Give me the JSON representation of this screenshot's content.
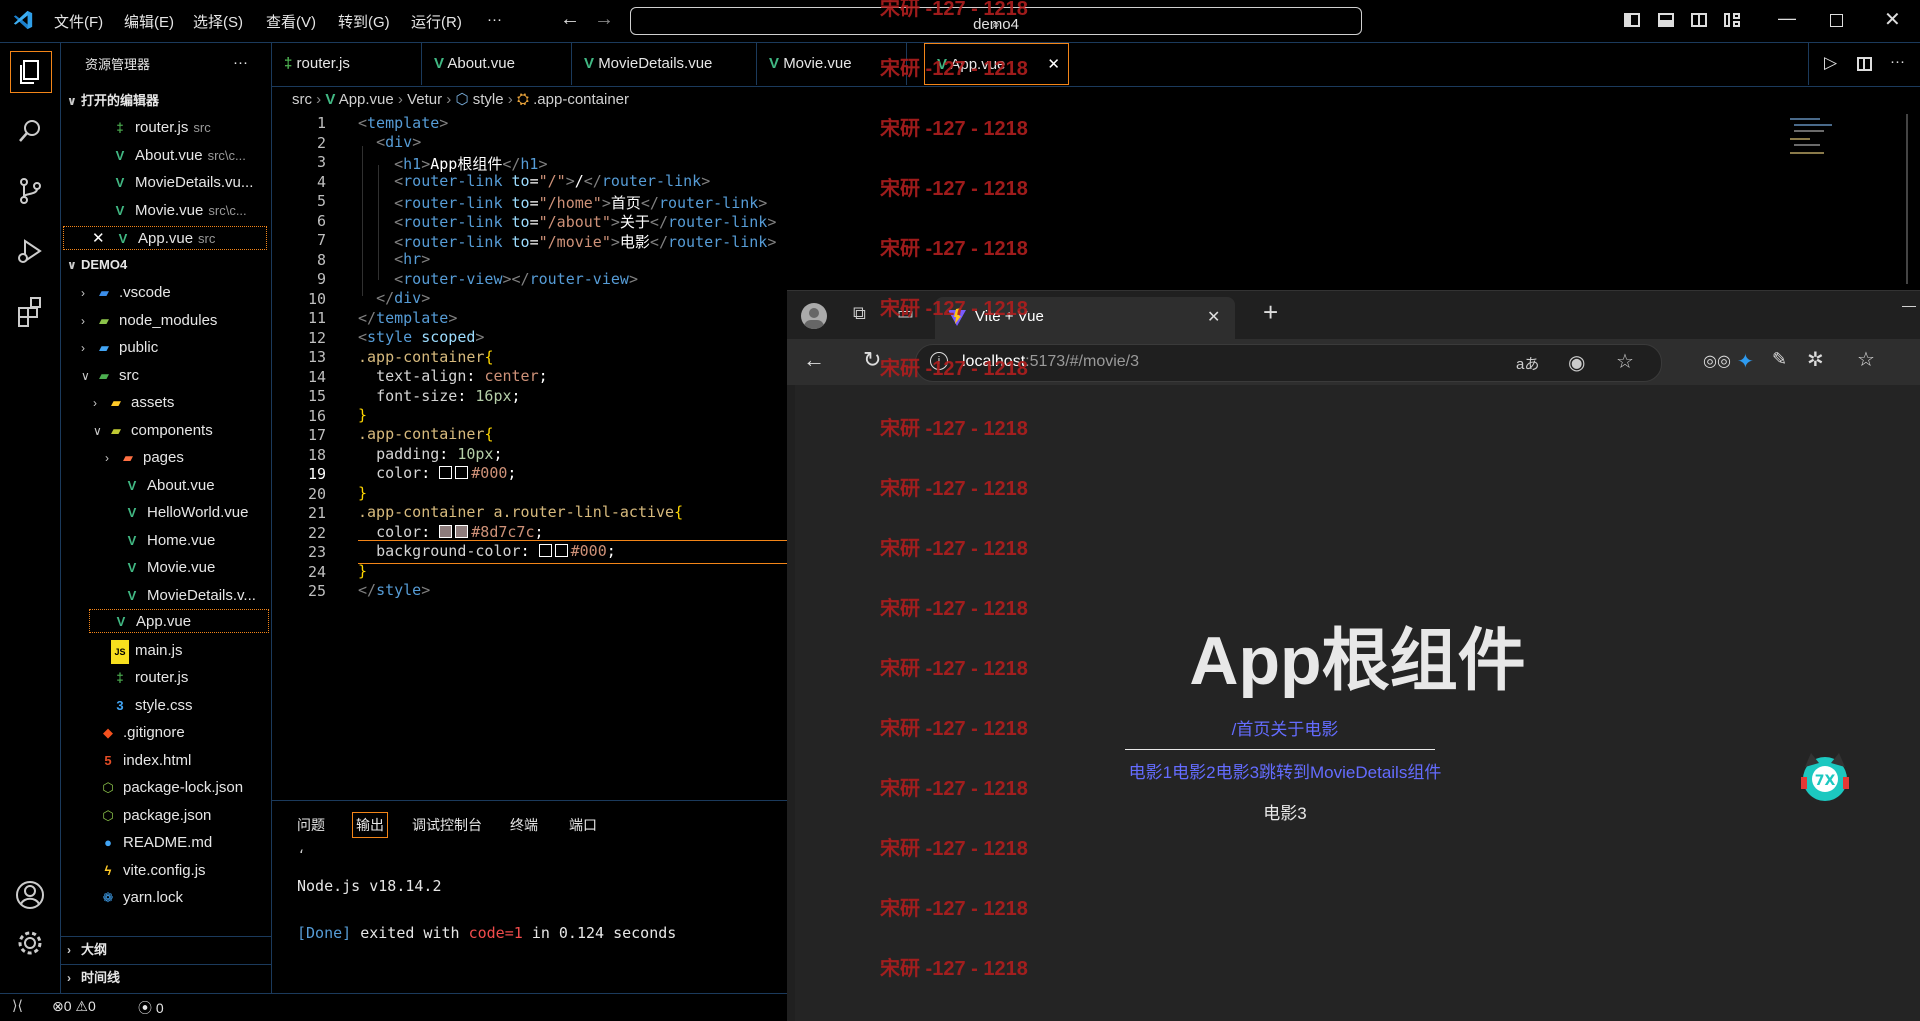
{
  "menu": [
    "文件(F)",
    "编辑(E)",
    "选择(S)",
    "查看(V)",
    "转到(G)",
    "运行(R)",
    "···"
  ],
  "search": {
    "text": "demo4"
  },
  "sidebar": {
    "title": "资源管理器",
    "more": "···",
    "open_editors_head": "打开的编辑器",
    "open_editors": [
      {
        "name": "router.js",
        "desc": "src"
      },
      {
        "name": "About.vue",
        "desc": "src\\c..."
      },
      {
        "name": "MovieDetails.vu...",
        "desc": ""
      },
      {
        "name": "Movie.vue",
        "desc": "src\\c..."
      },
      {
        "name": "App.vue",
        "desc": "src"
      }
    ],
    "project_head": "DEMO4",
    "tree": [
      ".vscode",
      "node_modules",
      "public",
      "src",
      "assets",
      "components",
      "pages",
      "About.vue",
      "HelloWorld.vue",
      "Home.vue",
      "Movie.vue",
      "MovieDetails.v...",
      "App.vue",
      "main.js",
      "router.js",
      "style.css",
      ".gitignore",
      "index.html",
      "package-lock.json",
      "package.json",
      "README.md",
      "vite.config.js",
      "yarn.lock"
    ],
    "outline_head": "大纲",
    "timeline_head": "时间线"
  },
  "tabs": [
    "router.js",
    "About.vue",
    "MovieDetails.vue",
    "Movie.vue",
    "App.vue"
  ],
  "breadcrumb": [
    "src",
    "App.vue",
    "Vetur",
    "style",
    ".app-container"
  ],
  "panel_tabs": [
    "问题",
    "输出",
    "调试控制台",
    "终端",
    "端口"
  ],
  "output": {
    "mark": "،",
    "node": "Node.js v18.14.2",
    "done_tag": "[Done]",
    "done_a": "exited with",
    "done_code": "code=1",
    "done_b": "in 0.124 seconds"
  },
  "status": {
    "errors": "0",
    "warnings": "0",
    "ports": "0"
  },
  "watermark": "宋研 -127 - 1218",
  "browser": {
    "tab_title": "Vite + Vue",
    "url_host": "localhost",
    "url_rest": ":5173/#/movie/3",
    "app_title": "App根组件",
    "nav_links": "/首页关于电影",
    "movie_links": "电影1电影2电影3跳转到MovieDetails组件",
    "current": "电影3"
  },
  "code_lines": 25,
  "colors": {
    "accent": "#f38518",
    "border": "#1b3a5c",
    "vue": "#41b883",
    "link": "#646cff"
  }
}
